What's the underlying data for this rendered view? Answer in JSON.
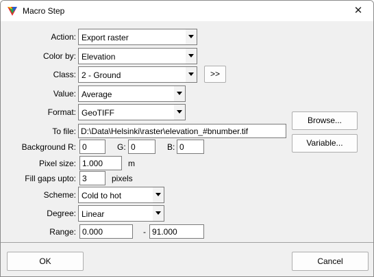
{
  "window": {
    "title": "Macro Step",
    "close_glyph": "✕",
    "icon": "tri-color-triangle-icon"
  },
  "labels": {
    "action": "Action:",
    "color_by": "Color by:",
    "class": "Class:",
    "value": "Value:",
    "format": "Format:",
    "to_file": "To file:",
    "background_r": "Background R:",
    "g": "G:",
    "b": "B:",
    "pixel_size": "Pixel size:",
    "fill_gaps": "Fill gaps upto:",
    "scheme": "Scheme:",
    "degree": "Degree:",
    "range": "Range:"
  },
  "fields": {
    "action": "Export raster",
    "color_by": "Elevation",
    "class": "2 - Ground",
    "value": "Average",
    "format": "GeoTIFF",
    "to_file": "D:\\Data\\Helsinki\\raster\\elevation_#bnumber.tif",
    "background_r": "0",
    "background_g": "0",
    "background_b": "0",
    "pixel_size": "1.000",
    "fill_gaps": "3",
    "scheme": "Cold to hot",
    "degree": "Linear",
    "range_min": "0.000",
    "range_max": "91.000"
  },
  "units": {
    "pixel_size": "m",
    "fill_gaps": "pixels",
    "range_dash": "-"
  },
  "buttons": {
    "class_more": ">>",
    "browse": "Browse...",
    "variable": "Variable...",
    "ok": "OK",
    "cancel": "Cancel"
  }
}
